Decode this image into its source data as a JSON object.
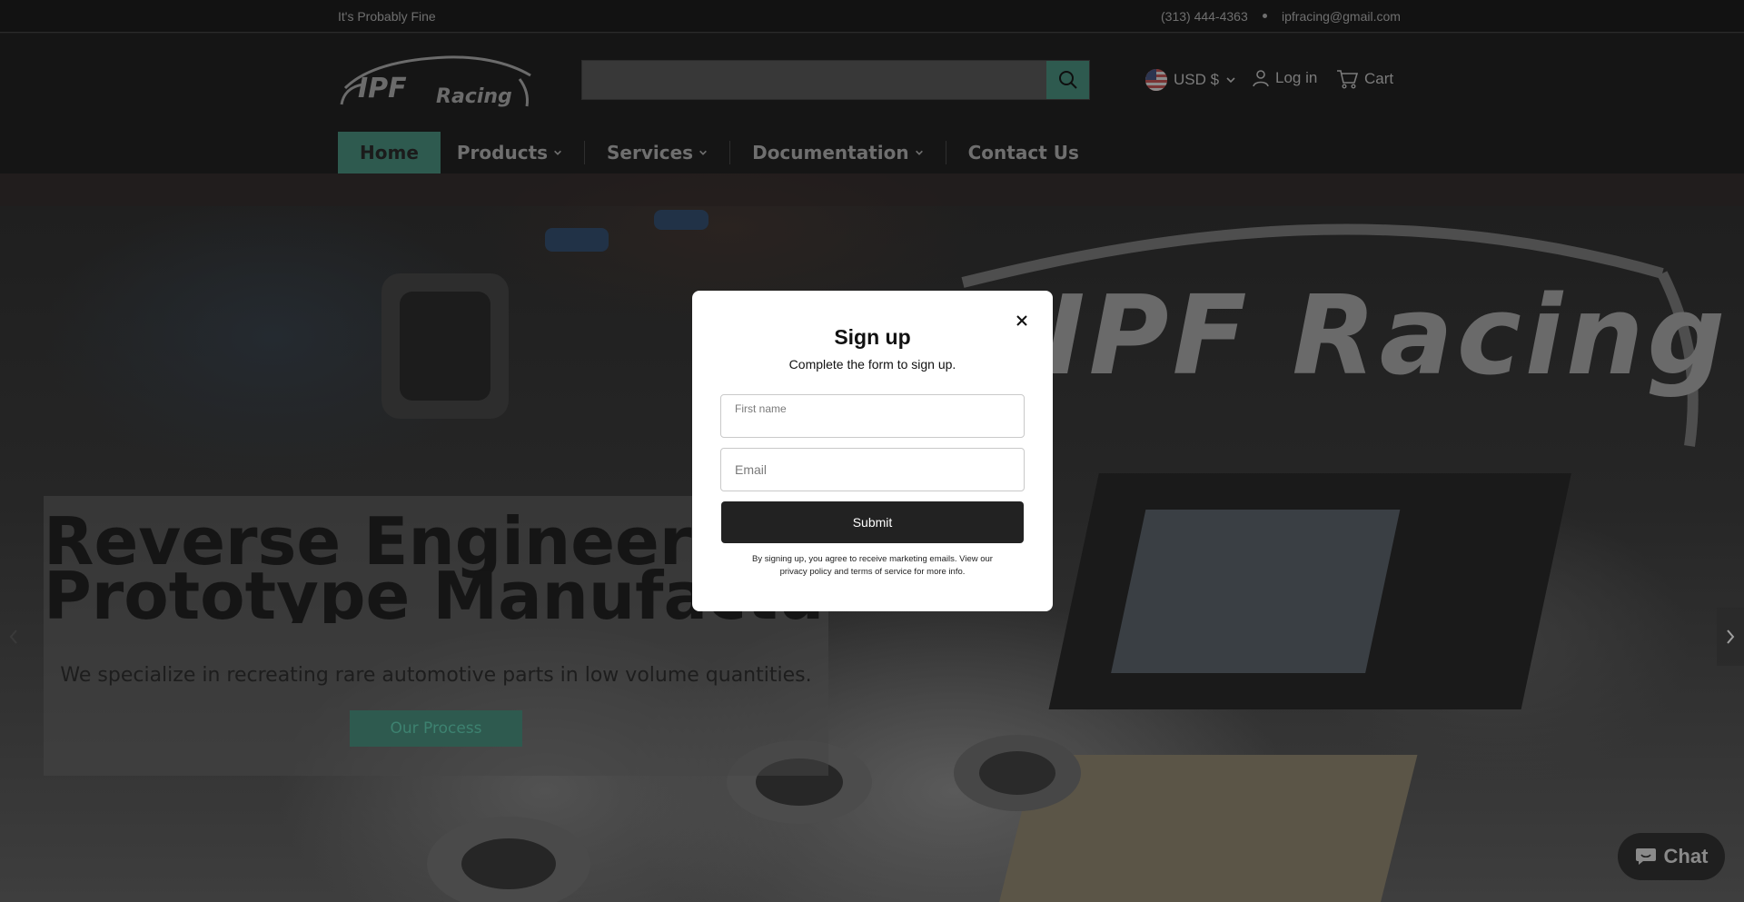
{
  "topbar": {
    "tagline": "It's Probably Fine",
    "phone": "(313) 444-4363",
    "email": "ipfracing@gmail.com"
  },
  "header": {
    "logo_text": "IPF Racing",
    "search": {
      "value": "",
      "placeholder": ""
    },
    "currency": "USD $",
    "login": "Log in",
    "cart": "Cart"
  },
  "nav": {
    "items": [
      {
        "label": "Home",
        "active": true
      },
      {
        "label": "Products",
        "dropdown": true
      },
      {
        "label": "Services",
        "dropdown": true
      },
      {
        "label": "Documentation",
        "dropdown": true
      },
      {
        "label": "Contact Us"
      }
    ]
  },
  "hero": {
    "background_text": "IPF Racing",
    "title_line1": "Reverse Engineering and",
    "title_line2": "Prototype Manufacturing",
    "subtitle": "We specialize in recreating rare automotive parts in low volume quantities.",
    "button": "Our Process"
  },
  "modal": {
    "title": "Sign up",
    "description": "Complete the form to sign up.",
    "first_name_label": "First name",
    "email_label": "Email",
    "submit": "Submit",
    "legal": "By signing up, you agree to receive marketing emails. View our privacy policy and terms of service for more info."
  },
  "chat": {
    "label": "Chat"
  },
  "colors": {
    "accent": "#2e5a4f",
    "topbar_bg": "#121212",
    "header_bg": "#151515",
    "modal_bg": "#ffffff",
    "submit_bg": "#222222"
  }
}
